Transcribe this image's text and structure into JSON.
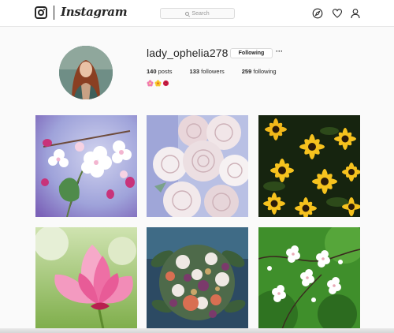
{
  "header": {
    "logo_text": "Instagram",
    "search_placeholder": "Search",
    "icons": [
      "instagram-logo-icon",
      "search-icon",
      "explore-compass-icon",
      "activity-heart-icon",
      "profile-user-icon"
    ]
  },
  "profile": {
    "username": "lady_ophelia278",
    "follow_state_label": "Following",
    "more_label": "···",
    "posts_count": "140",
    "posts_label": "posts",
    "followers_count": "133",
    "followers_label": "followers",
    "following_count": "259",
    "following_label": "following",
    "bio_emojis": [
      "pink-flower",
      "yellow-flower",
      "red-rose"
    ]
  },
  "posts": [
    {
      "subject": "apple-blossom-branch"
    },
    {
      "subject": "white-roses-bouquet"
    },
    {
      "subject": "yellow-black-eyed-susans"
    },
    {
      "subject": "pink-lotus"
    },
    {
      "subject": "mixed-flower-bouquet"
    },
    {
      "subject": "white-blossoms-on-green"
    }
  ],
  "colors": {
    "background": "#fafafa",
    "text": "#262626",
    "border": "#dbdbdb"
  }
}
